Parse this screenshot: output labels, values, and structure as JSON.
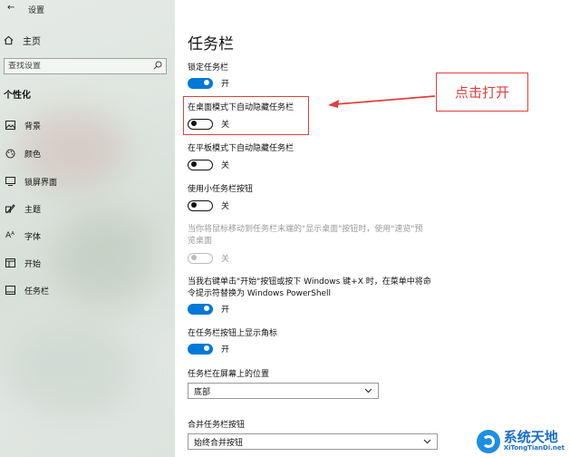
{
  "app": {
    "title": "设置",
    "back_glyph": "←"
  },
  "sidebar": {
    "home_label": "主页",
    "search": {
      "placeholder": "查找设置"
    },
    "section_title": "个性化",
    "items": [
      {
        "label": "背景",
        "icon": "image-icon"
      },
      {
        "label": "颜色",
        "icon": "palette-icon"
      },
      {
        "label": "锁屏界面",
        "icon": "lock-screen-icon"
      },
      {
        "label": "主题",
        "icon": "brush-icon"
      },
      {
        "label": "字体",
        "icon": "font-icon"
      },
      {
        "label": "开始",
        "icon": "start-menu-icon"
      },
      {
        "label": "任务栏",
        "icon": "taskbar-icon"
      }
    ]
  },
  "main": {
    "title": "任务栏",
    "settings": [
      {
        "label": "锁定任务栏",
        "state": "on",
        "state_text": "开"
      },
      {
        "label": "在桌面模式下自动隐藏任务栏",
        "state": "off",
        "state_text": "关"
      },
      {
        "label": "在平板模式下自动隐藏任务栏",
        "state": "off",
        "state_text": "关"
      },
      {
        "label": "使用小任务栏按钮",
        "state": "off",
        "state_text": "关"
      },
      {
        "label_line1": "当你将鼠标移动到任务栏末端的\"显示桌面\"按钮时，使用\"速览\"预",
        "label_line2": "览桌面",
        "state": "disabled",
        "state_text": "关"
      },
      {
        "label_line1": "当我右键单击\"开始\"按钮或按下 Windows 键+X 时，在菜单中将命",
        "label_line2": "令提示符替换为 Windows PowerShell",
        "state": "on",
        "state_text": "开"
      },
      {
        "label": "在任务栏按钮上显示角标",
        "state": "on",
        "state_text": "开"
      }
    ],
    "position": {
      "label": "任务栏在屏幕上的位置",
      "value": "底部"
    },
    "combine": {
      "label": "合并任务栏按钮",
      "value": "始终合并按钮"
    }
  },
  "annotation": {
    "callout_text": "点击打开",
    "color": "#e0403f"
  },
  "watermark": {
    "cn": "系统天地",
    "en": "XiTongTianDi.net"
  },
  "colors": {
    "accent": "#0078d7"
  }
}
